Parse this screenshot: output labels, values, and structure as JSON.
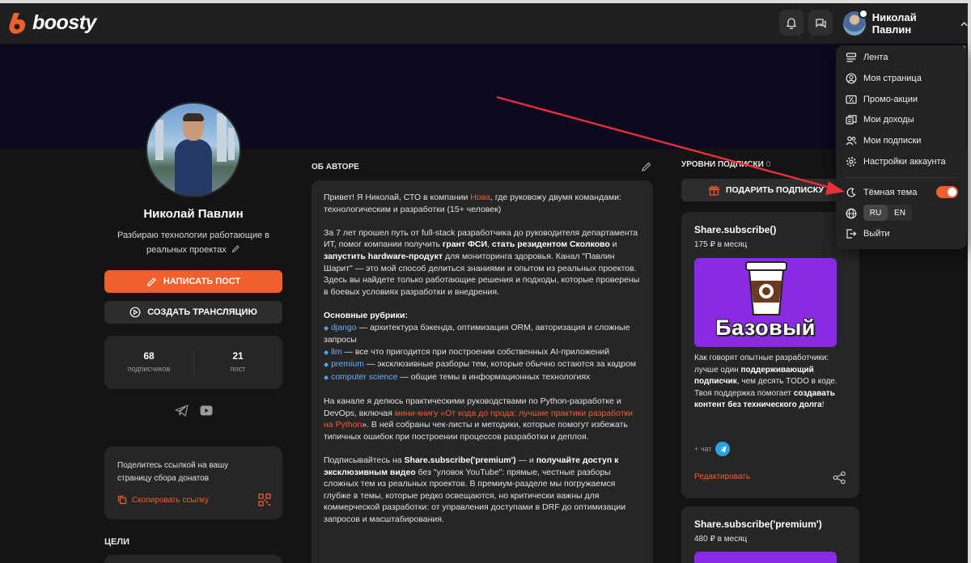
{
  "header": {
    "logo_text": "boosty",
    "user_name": "Николай Павлин"
  },
  "menu": {
    "items": [
      "Лента",
      "Моя страница",
      "Промо-акции",
      "Мои доходы",
      "Мои подписки",
      "Настройки аккаунта"
    ],
    "dark_theme_label": "Тёмная тема",
    "dark_theme_on": true,
    "languages": [
      "RU",
      "EN"
    ],
    "active_language": "RU",
    "logout": "Выйти"
  },
  "profile": {
    "name": "Николай Павлин",
    "description": "Разбираю технологии работающие в реальных проектах",
    "write_post": "НАПИСАТЬ ПОСТ",
    "create_stream": "СОЗДАТЬ ТРАНСЛЯЦИЮ",
    "subscribers_count": "68",
    "subscribers_label": "подписчиков",
    "posts_count": "21",
    "posts_label": "пост",
    "share_text": "Поделитесь ссылкой на вашу страницу сбора донатов",
    "copy_link": "Скопировать ссылку",
    "goals_title": "ЦЕЛИ"
  },
  "about": {
    "title": "ОБ АВТОРЕ",
    "p1_a": "Привет! Я Николай, СТО в компании ",
    "p1_link": "Нова",
    "p1_b": ", где руковожу двумя командами: технологическим и разработки (15+ человек)",
    "p2_a": "За 7 лет прошел путь от full-stack разработчика до руководителя департамента ИТ, помог компании получить ",
    "p2_b1": "грант ФСИ",
    "p2_c": ", ",
    "p2_b2": "стать резидентом Сколково",
    "p2_d": " и ",
    "p2_b3": "запустить hardware-продукт",
    "p2_e": " для мониторинга здоровья. Канал \"Павлин Шарит\" — это мой способ делиться знаниями и опытом из реальных проектов. Здесь вы найдете только работающие решения и подходы, которые проверены в боевых условиях разработки и внедрения.",
    "rubrics_title": "Основные рубрики:",
    "rubrics": [
      {
        "tag": "django",
        "text": " — архитектура бэкенда, оптимизация ORM, авторизация и сложные запросы"
      },
      {
        "tag": "llm",
        "text": " — все что пригодится при построении собственных AI-приложений"
      },
      {
        "tag": "premium",
        "text": " — эксклюзивные разборы тем, которые обычно остаются за кадром"
      },
      {
        "tag": "computer science",
        "text": " — общие темы в информационных технологиях"
      }
    ],
    "p4_a": "На канале я делюсь практическими руководствами по Python-разработке и DevOps, включая ",
    "p4_link": "мини-книгу «От кода до прода: лучшие практики разработки на Python",
    "p4_b": "». В ней собраны чек-листы и методики, которые помогут избежать типичных ошибок при построении процессов разработки и деплоя.",
    "p5_a": "Подписывайтесь на ",
    "p5_b1": "Share.subscribe('premium')",
    "p5_c": " — и ",
    "p5_b2": "получайте доступ к эксклюзивным видео",
    "p5_d": " без \"уловок YouTube\": прямые, честные разборы сложных тем из реальных проектов. В премиум-разделе мы погружаемся глубже в темы, которые редко освещаются, но критически важны для коммерческой разработки: от управления доступами в DRF до оптимизации запросов и масштабирования."
  },
  "levels": {
    "title": "УРОВНИ ПОДПИСКИ",
    "count": "0",
    "gift_button": "ПОДАРИТЬ ПОДПИСКУ",
    "tiers": [
      {
        "name": "Share.subscribe()",
        "price": "175 ₽ в месяц",
        "image_text": "Базовый",
        "desc_a": "Как говорят опытные разработчики: лучше один ",
        "desc_b1": "поддерживающий подписчик",
        "desc_c": ", чем десять TODO в коде.",
        "desc_d": "Твоя поддержка помогает ",
        "desc_b2": "создавать контент без технического долга",
        "desc_e": "!",
        "chat": "+ чат",
        "edit": "Редактировать"
      },
      {
        "name": "Share.subscribe('premium')",
        "price": "480 ₽ в месяц"
      }
    ]
  },
  "colors": {
    "accent": "#f15f2c",
    "background": "#141414",
    "card": "#262626",
    "tier_image": "#8a2be2",
    "annotation_arrow": "#e8303a"
  }
}
